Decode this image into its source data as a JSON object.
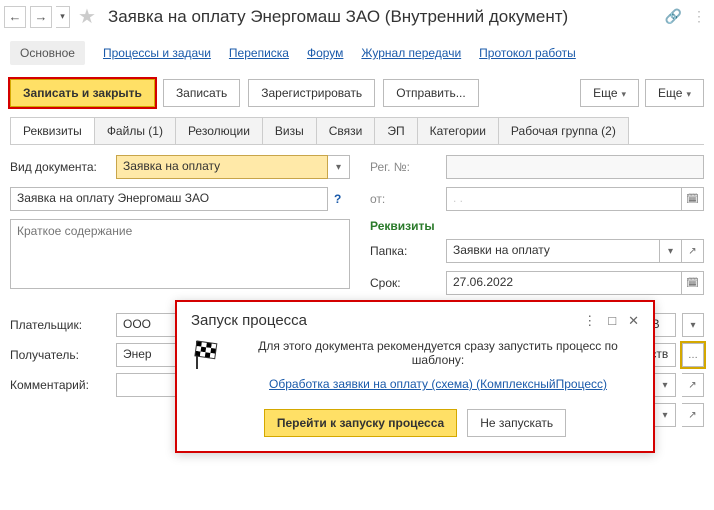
{
  "title": "Заявка на оплату Энергомаш ЗАО (Внутренний документ)",
  "sectionTabs": {
    "main": "Основное",
    "links": [
      "Процессы и задачи",
      "Переписка",
      "Форум",
      "Журнал передачи",
      "Протокол работы"
    ]
  },
  "toolbar": {
    "saveClose": "Записать и закрыть",
    "save": "Записать",
    "register": "Зарегистрировать",
    "send": "Отправить...",
    "more1": "Еще",
    "more2": "Еще"
  },
  "tabs": [
    "Реквизиты",
    "Файлы (1)",
    "Резолюции",
    "Визы",
    "Связи",
    "ЭП",
    "Категории",
    "Рабочая группа (2)"
  ],
  "form": {
    "docTypeLabel": "Вид документа:",
    "docType": "Заявка на оплату",
    "docName": "Заявка на оплату Энергомаш ЗАО",
    "descPlaceholder": "Краткое содержание",
    "regNoLabel": "Рег. №:",
    "fromLabel": "от:",
    "fromPlaceholder": "   .   .",
    "reqHeader": "Реквизиты",
    "folderLabel": "Папка:",
    "folder": "Заявки на оплату",
    "deadlineLabel": "Срок:",
    "deadline": "27.06.2022"
  },
  "bottom": {
    "payerLabel": "Плательщик:",
    "payer": "ООО",
    "currency": "UB",
    "receiverLabel": "Получатель:",
    "receiver": "Энер",
    "receiverExtra": "едств",
    "commentLabel": "Комментарий:"
  },
  "dialog": {
    "title": "Запуск процесса",
    "text": "Для этого документа рекомендуется сразу запустить процесс по шаблону:",
    "link": "Обработка заявки на оплату (схема) (КомплексныйПроцесс)",
    "go": "Перейти к запуску процесса",
    "skip": "Не запускать"
  }
}
